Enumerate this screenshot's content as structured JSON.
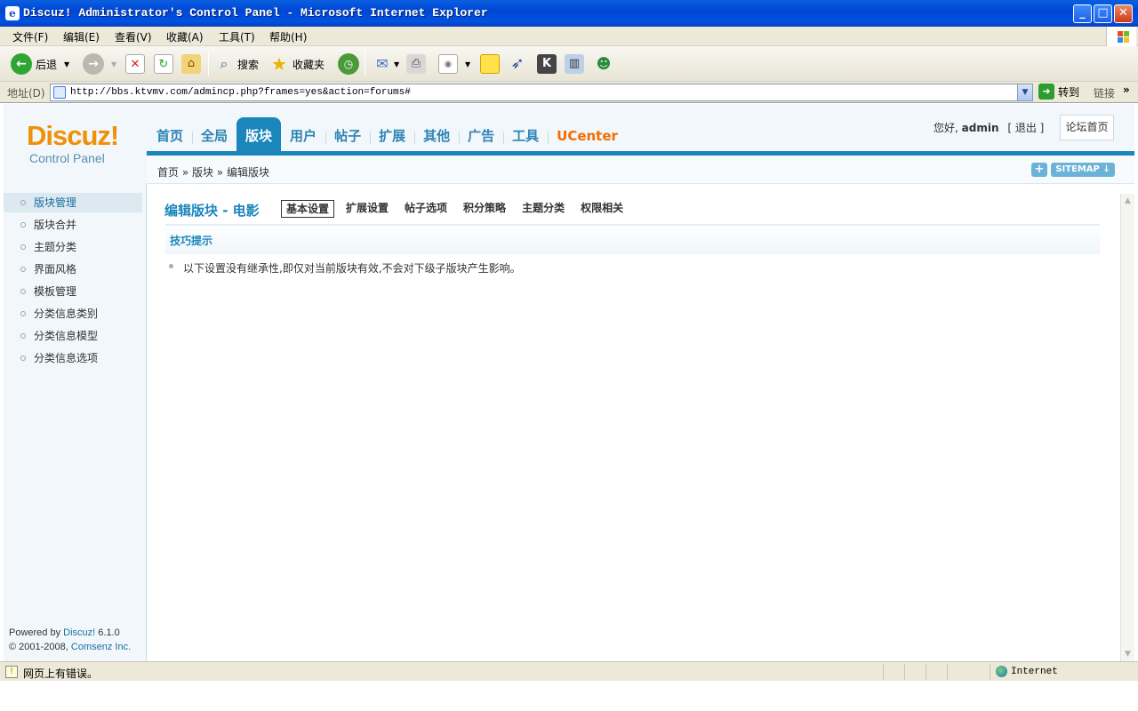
{
  "window": {
    "title": "Discuz! Administrator's Control Panel - Microsoft Internet Explorer",
    "min": "_",
    "max": "□",
    "close": "✕"
  },
  "menu": [
    "文件(F)",
    "编辑(E)",
    "查看(V)",
    "收藏(A)",
    "工具(T)",
    "帮助(H)"
  ],
  "toolbar": {
    "back_label": "后退",
    "search_label": "搜索",
    "favorites_label": "收藏夹"
  },
  "address": {
    "label": "地址(D)",
    "url": "http://bbs.ktvmv.com/admincp.php?frames=yes&action=forums#",
    "go_label": "转到",
    "links_label": "链接"
  },
  "header": {
    "logo_word": "Discuz!",
    "logo_sub": "Control Panel",
    "nav": [
      "首页",
      "全局",
      "版块",
      "用户",
      "帖子",
      "扩展",
      "其他",
      "广告",
      "工具",
      "UCenter"
    ],
    "active_nav": "版块",
    "greeting": "您好,",
    "username": "admin",
    "logout": "[ 退出 ]",
    "forum_home": "论坛首页",
    "breadcrumb": "首页 » 版块 » 编辑版块",
    "plus": "+",
    "sitemap": "SITEMAP ↓"
  },
  "sidebar": {
    "items": [
      "版块管理",
      "版块合并",
      "主题分类",
      "界面风格",
      "模板管理",
      "分类信息类别",
      "分类信息模型",
      "分类信息选项"
    ],
    "active_index": 0,
    "powered_prefix": "Powered by ",
    "powered_link": "Discuz!",
    "version": " 6.1.0",
    "copyright_prefix": "© 2001-2008, ",
    "company": "Comsenz Inc."
  },
  "main": {
    "title": "编辑版块 - 电影",
    "tabs": [
      "基本设置",
      "扩展设置",
      "帖子选项",
      "积分策略",
      "主题分类",
      "权限相关"
    ],
    "active_tab": "基本设置",
    "tip_title": "技巧提示",
    "tip_text": "以下设置没有继承性,即仅对当前版块有效,不会对下级子版块产生影响。"
  },
  "status": {
    "message": "网页上有错误。",
    "zone": "Internet"
  },
  "colors": {
    "accent": "#1a86bb",
    "brand_orange": "#f0900a",
    "ucenter": "#f26c00",
    "xp_blue": "#0046d5"
  }
}
